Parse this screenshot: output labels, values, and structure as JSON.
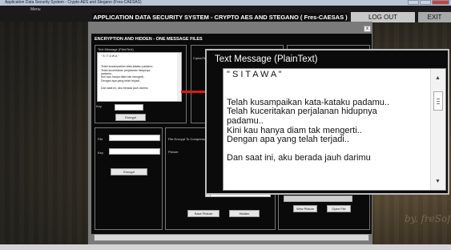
{
  "window": {
    "title": "Application Data Security System - Crypto AES and Stegano (Fres-CAESAS)"
  },
  "menubar": {
    "menu_label": "Menu"
  },
  "header": {
    "title": "APPLICATION DATA SECURITY SYSTEM - CRYPTO AES AND STEGANO ( Fres-CAESAS )",
    "logout_label": "LOG OUT",
    "exit_label": "EXIT"
  },
  "panel": {
    "close_label": "x",
    "title": "ENCRYPTION AND HIDDEN - ONE MESSAGE FILES",
    "plaintext_group_label": "Text Message (PlainText)",
    "ciphertext_label": "CipherText",
    "key_label": "Key",
    "encrypt_label": "Encrypt",
    "file_label": "File",
    "key2_label": "Key",
    "encrypt2_label": "Encrypt",
    "file_encrypt_label": "File Encrypt To Compress",
    "picture_label": "Picture",
    "save_picture_label": "Save Picture",
    "hidden_label": "Hidden",
    "view_picture_label": "View Picture",
    "open_file_label": "Open File"
  },
  "message": {
    "title": "Text Message (PlainText)",
    "lines": [
      "\" S I T A W A \"",
      "",
      "",
      "Telah kusampaikan kata-kataku padamu..",
      "Telah kuceritakan perjalanan hidupnya",
      "padamu..",
      "Kini kau hanya diam tak mengerti..",
      "Dengan apa yang telah terjadi..",
      "",
      "Dan saat ini, aku berada jauh darimu"
    ]
  },
  "watermark": {
    "text": "by. freSoft"
  },
  "colors": {
    "arrow": "#e01818",
    "panel": "#7a7a7a",
    "header_bg": "#0e0e0e"
  }
}
